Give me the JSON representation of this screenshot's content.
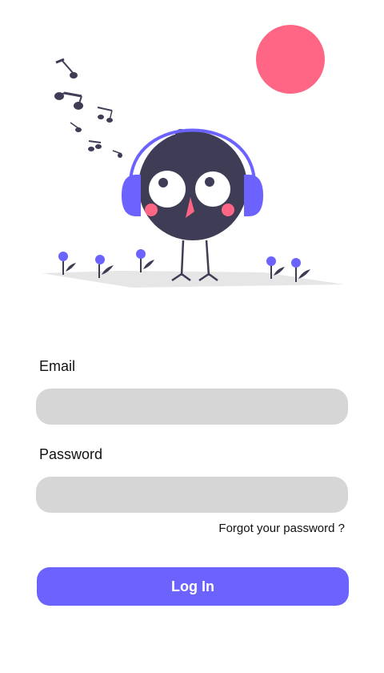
{
  "form": {
    "email_label": "Email",
    "email_value": "",
    "email_placeholder": "",
    "password_label": "Password",
    "password_value": "",
    "password_placeholder": "",
    "forgot_label": "Forgot your password ?",
    "login_label": "Log In"
  },
  "colors": {
    "accent": "#6c63ff",
    "sun": "#ff6584",
    "bird_body": "#3f3d56",
    "input_bg": "#d6d6d6",
    "ground": "#e6e6e6"
  },
  "illustration": {
    "subject": "bird-with-headphones",
    "icons": [
      "sun-icon",
      "music-notes-icon",
      "flower-icon"
    ]
  }
}
